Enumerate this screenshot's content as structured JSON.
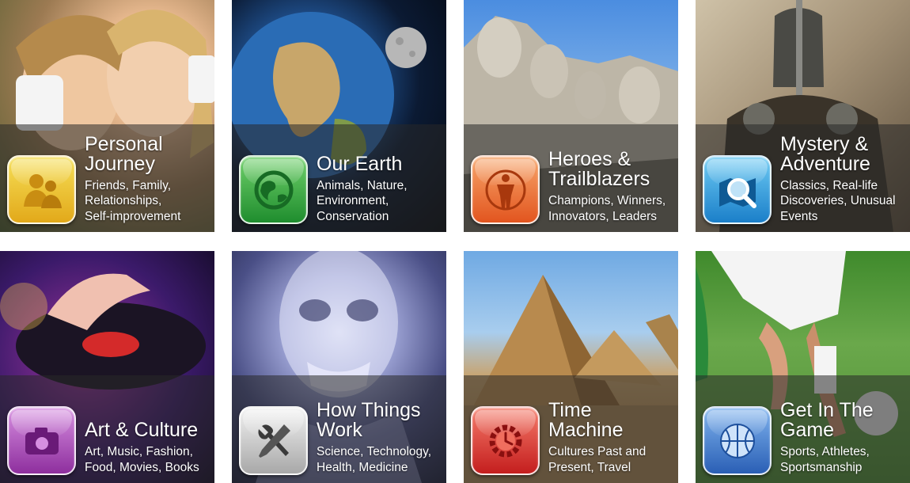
{
  "tiles": [
    {
      "id": "personal-journey",
      "icon": "people-icon",
      "color": "#e8b21f",
      "title_lines": [
        "Personal",
        "Journey"
      ],
      "subtitle_lines": [
        "Friends, Family,",
        "Relationships,",
        "Self-improvement"
      ]
    },
    {
      "id": "our-earth",
      "icon": "globe-icon",
      "color": "#2fa23a",
      "title_lines": [
        "Our Earth"
      ],
      "subtitle_lines": [
        "Animals, Nature,",
        "Environment,",
        "Conservation"
      ]
    },
    {
      "id": "heroes-trailblazers",
      "icon": "hero-icon",
      "color": "#ea6a2c",
      "title_lines": [
        "Heroes &",
        "Trailblazers"
      ],
      "subtitle_lines": [
        "Champions, Winners,",
        "Innovators, Leaders"
      ]
    },
    {
      "id": "mystery-adventure",
      "icon": "magnifier-icon",
      "color": "#2591d6",
      "title_lines": [
        "Mystery &",
        "Adventure"
      ],
      "subtitle_lines": [
        "Classics, Real-life",
        "Discoveries, Unusual",
        "Events"
      ]
    },
    {
      "id": "art-culture",
      "icon": "camera-icon",
      "color": "#a340b3",
      "title_lines": [
        "Art & Culture"
      ],
      "subtitle_lines": [
        "Art, Music, Fashion,",
        "Food, Movies, Books"
      ]
    },
    {
      "id": "how-things-work",
      "icon": "tools-icon",
      "color": "#b5b5b5",
      "title_lines": [
        "How Things",
        "Work"
      ],
      "subtitle_lines": [
        "Science, Technology,",
        "Health, Medicine"
      ]
    },
    {
      "id": "time-machine",
      "icon": "gear-clock-icon",
      "color": "#d12a24",
      "title_lines": [
        "Time",
        "Machine"
      ],
      "subtitle_lines": [
        "Cultures Past and",
        "Present, Travel"
      ]
    },
    {
      "id": "get-in-the-game",
      "icon": "basketball-icon",
      "color": "#3670c4",
      "title_lines": [
        "Get In The",
        "Game"
      ],
      "subtitle_lines": [
        "Sports, Athletes,",
        "Sportsmanship"
      ]
    }
  ]
}
